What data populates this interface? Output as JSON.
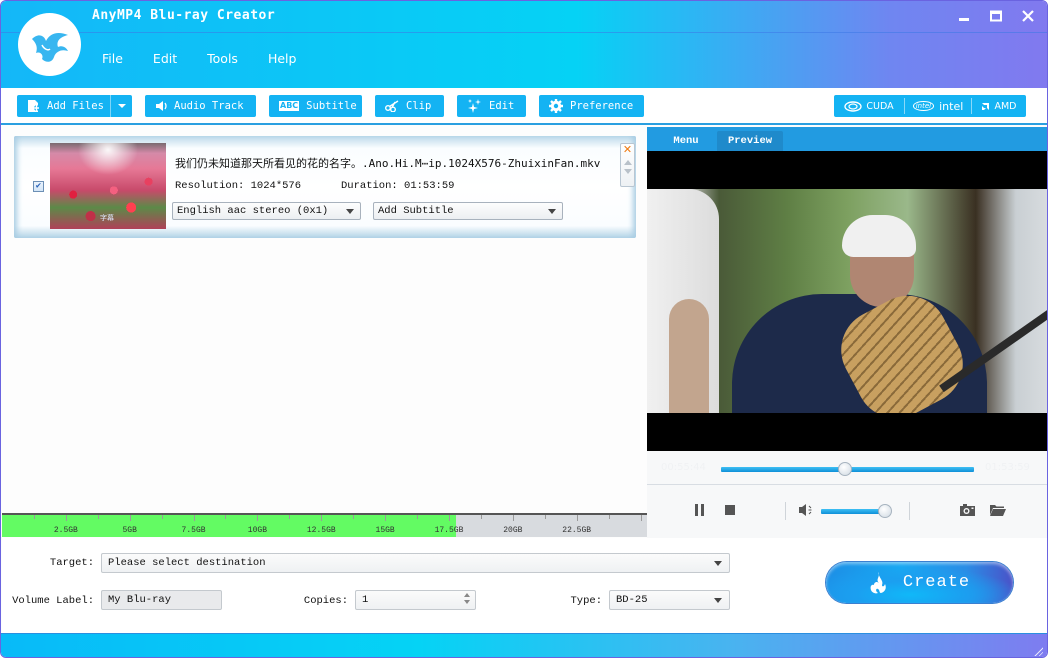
{
  "app": {
    "title": "AnyMP4 Blu-ray Creator",
    "brand_color": "#14b3f3"
  },
  "window_controls": {
    "minimize": "minimize-icon",
    "maximize": "maximize-icon",
    "close": "close-icon"
  },
  "menubar": {
    "items": [
      {
        "label": "File"
      },
      {
        "label": "Edit"
      },
      {
        "label": "Tools"
      },
      {
        "label": "Help"
      }
    ]
  },
  "toolbar": {
    "add_files": "Add Files",
    "audio_track": "Audio Track",
    "subtitle": "Subtitle",
    "subtitle_icon_text": "ABC",
    "clip": "Clip",
    "edit": "Edit",
    "preference": "Preference",
    "hw_accel": {
      "cuda": "CUDA",
      "intel": "intel",
      "intel_logo": "intel",
      "amd": "AMD"
    }
  },
  "file_list": {
    "items": [
      {
        "checked": true,
        "name": "我们仍未知道那天所看见的花的名字。.Ano.Hi.M⋯ip.1024X576-ZhuixinFan.mkv",
        "resolution_label": "Resolution:",
        "resolution": "1024*576",
        "duration_label": "Duration:",
        "duration": "01:53:59",
        "audio_track": "English aac stereo (0x1)",
        "subtitle": "Add Subtitle",
        "thumb_caption": "字幕"
      }
    ]
  },
  "storage_bar": {
    "used_gb": 17.6,
    "capacity_gb": 25,
    "fill_color": "#63fb63",
    "labels": [
      "2.5GB",
      "5GB",
      "7.5GB",
      "10GB",
      "12.5GB",
      "15GB",
      "17.5GB",
      "20GB",
      "22.5GB"
    ]
  },
  "preview": {
    "tabs": [
      {
        "label": "Menu",
        "active": false
      },
      {
        "label": "Preview",
        "active": true
      }
    ],
    "current_time": "00:55:44",
    "total_time": "01:53:59",
    "progress": 0.49,
    "volume": 0.97
  },
  "form": {
    "target_label": "Target:",
    "target_value": "Please select destination",
    "volume_label_label": "Volume Label:",
    "volume_label_value": "My Blu-ray",
    "copies_label": "Copies:",
    "copies_value": "1",
    "type_label": "Type:",
    "type_value": "BD-25"
  },
  "create_button": {
    "label": "Create"
  }
}
